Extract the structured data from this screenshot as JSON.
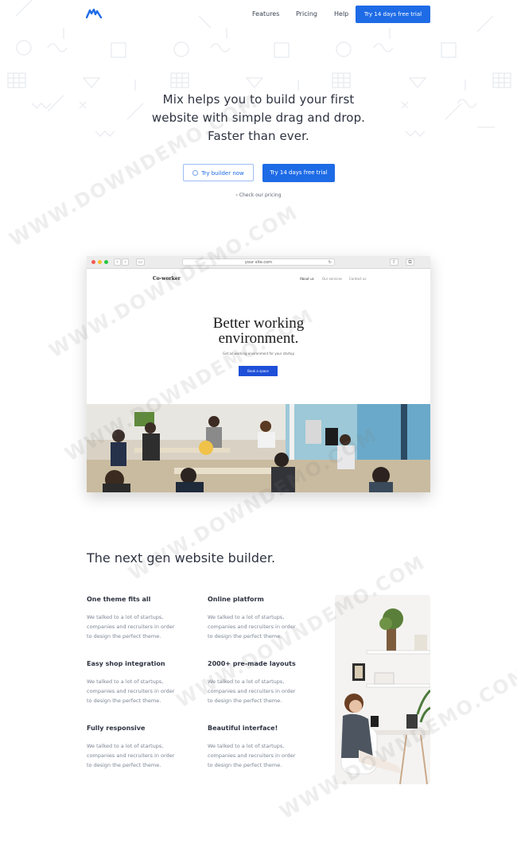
{
  "nav": {
    "links": [
      "Features",
      "Pricing",
      "Help"
    ],
    "cta": "Try 14 days free trial"
  },
  "hero": {
    "lines": [
      "Mix helps you to build your first",
      "website with simple drag and drop.",
      "Faster than ever."
    ],
    "primary_button": "Try builder now",
    "secondary_button": "Try 14 days free trial",
    "pricing_link": "› Check our pricing"
  },
  "browser": {
    "url": "your site.com",
    "site": {
      "brand": "Co-worker",
      "nav": [
        "About us",
        "Our services",
        "Contact us"
      ],
      "headline": [
        "Better working",
        "environment."
      ],
      "subtitle": "Get an working environment for your startup",
      "button": "Book a space"
    }
  },
  "features": {
    "title": "The next gen website builder.",
    "items": [
      {
        "title": "One theme fits all",
        "text": [
          "We talked to a lot of startups,",
          "companies and recruiters in order",
          "to design the perfect theme."
        ]
      },
      {
        "title": "Online platform",
        "text": [
          "We talked to a lot of startups,",
          "companies and recruiters in order",
          "to design the perfect theme."
        ]
      },
      {
        "title": "Easy shop integration",
        "text": [
          "We talked to a lot of startups,",
          "companies and recruiters in order",
          "to design the perfect theme."
        ]
      },
      {
        "title": "2000+ pre-made layouts",
        "text": [
          "We talked to a lot of startups,",
          "companies and recruiters in order",
          "to design the perfect theme."
        ]
      },
      {
        "title": "Fully responsive",
        "text": [
          "We talked to a lot of startups,",
          "companies and recruiters in order",
          "to design the perfect theme."
        ]
      },
      {
        "title": "Beautiful interface!",
        "text": [
          "We talked to a lot of startups,",
          "companies and recruiters in order",
          "to design the perfect theme."
        ]
      }
    ]
  },
  "watermark": "WWW.DOWNDEMO.COM",
  "colors": {
    "accent": "#1e6be6",
    "text": "#2d3340",
    "muted": "#7b8594"
  },
  "icons": [
    "mix-logo-icon",
    "user-circle-icon",
    "back-icon",
    "forward-icon",
    "sidebar-icon",
    "reload-icon",
    "share-icon",
    "tabs-icon"
  ]
}
